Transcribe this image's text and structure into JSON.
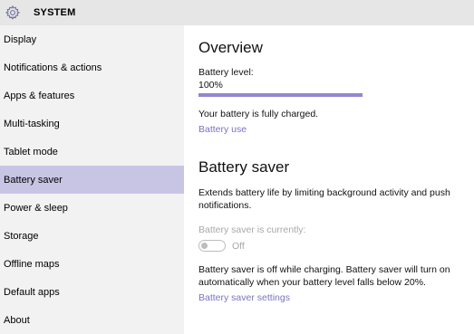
{
  "header": {
    "title": "SYSTEM",
    "icon": "gear-icon"
  },
  "sidebar": {
    "items": [
      {
        "label": "Display",
        "selected": false
      },
      {
        "label": "Notifications & actions",
        "selected": false
      },
      {
        "label": "Apps & features",
        "selected": false
      },
      {
        "label": "Multi-tasking",
        "selected": false
      },
      {
        "label": "Tablet mode",
        "selected": false
      },
      {
        "label": "Battery saver",
        "selected": true
      },
      {
        "label": "Power & sleep",
        "selected": false
      },
      {
        "label": "Storage",
        "selected": false
      },
      {
        "label": "Offline maps",
        "selected": false
      },
      {
        "label": "Default apps",
        "selected": false
      },
      {
        "label": "About",
        "selected": false
      }
    ]
  },
  "overview": {
    "heading": "Overview",
    "battery_level_label": "Battery level:",
    "battery_level_value": "100%",
    "battery_level_fraction": 1.0,
    "status": "Your battery is fully charged.",
    "battery_use_link": "Battery use"
  },
  "battery_saver": {
    "heading": "Battery saver",
    "description": "Extends battery life by limiting background activity and push notifications.",
    "currently_label": "Battery saver is currently:",
    "toggle_state": "Off",
    "toggle_on": false,
    "note": "Battery saver is off while charging. Battery saver will turn on automatically when your battery level falls below 20%.",
    "settings_link": "Battery saver settings"
  },
  "colors": {
    "accent": "#9088cf",
    "link": "#7a72c8",
    "selected_bg": "#c8c5e4",
    "sidebar_bg": "#f2f2f2",
    "header_bg": "#e6e6e6"
  }
}
